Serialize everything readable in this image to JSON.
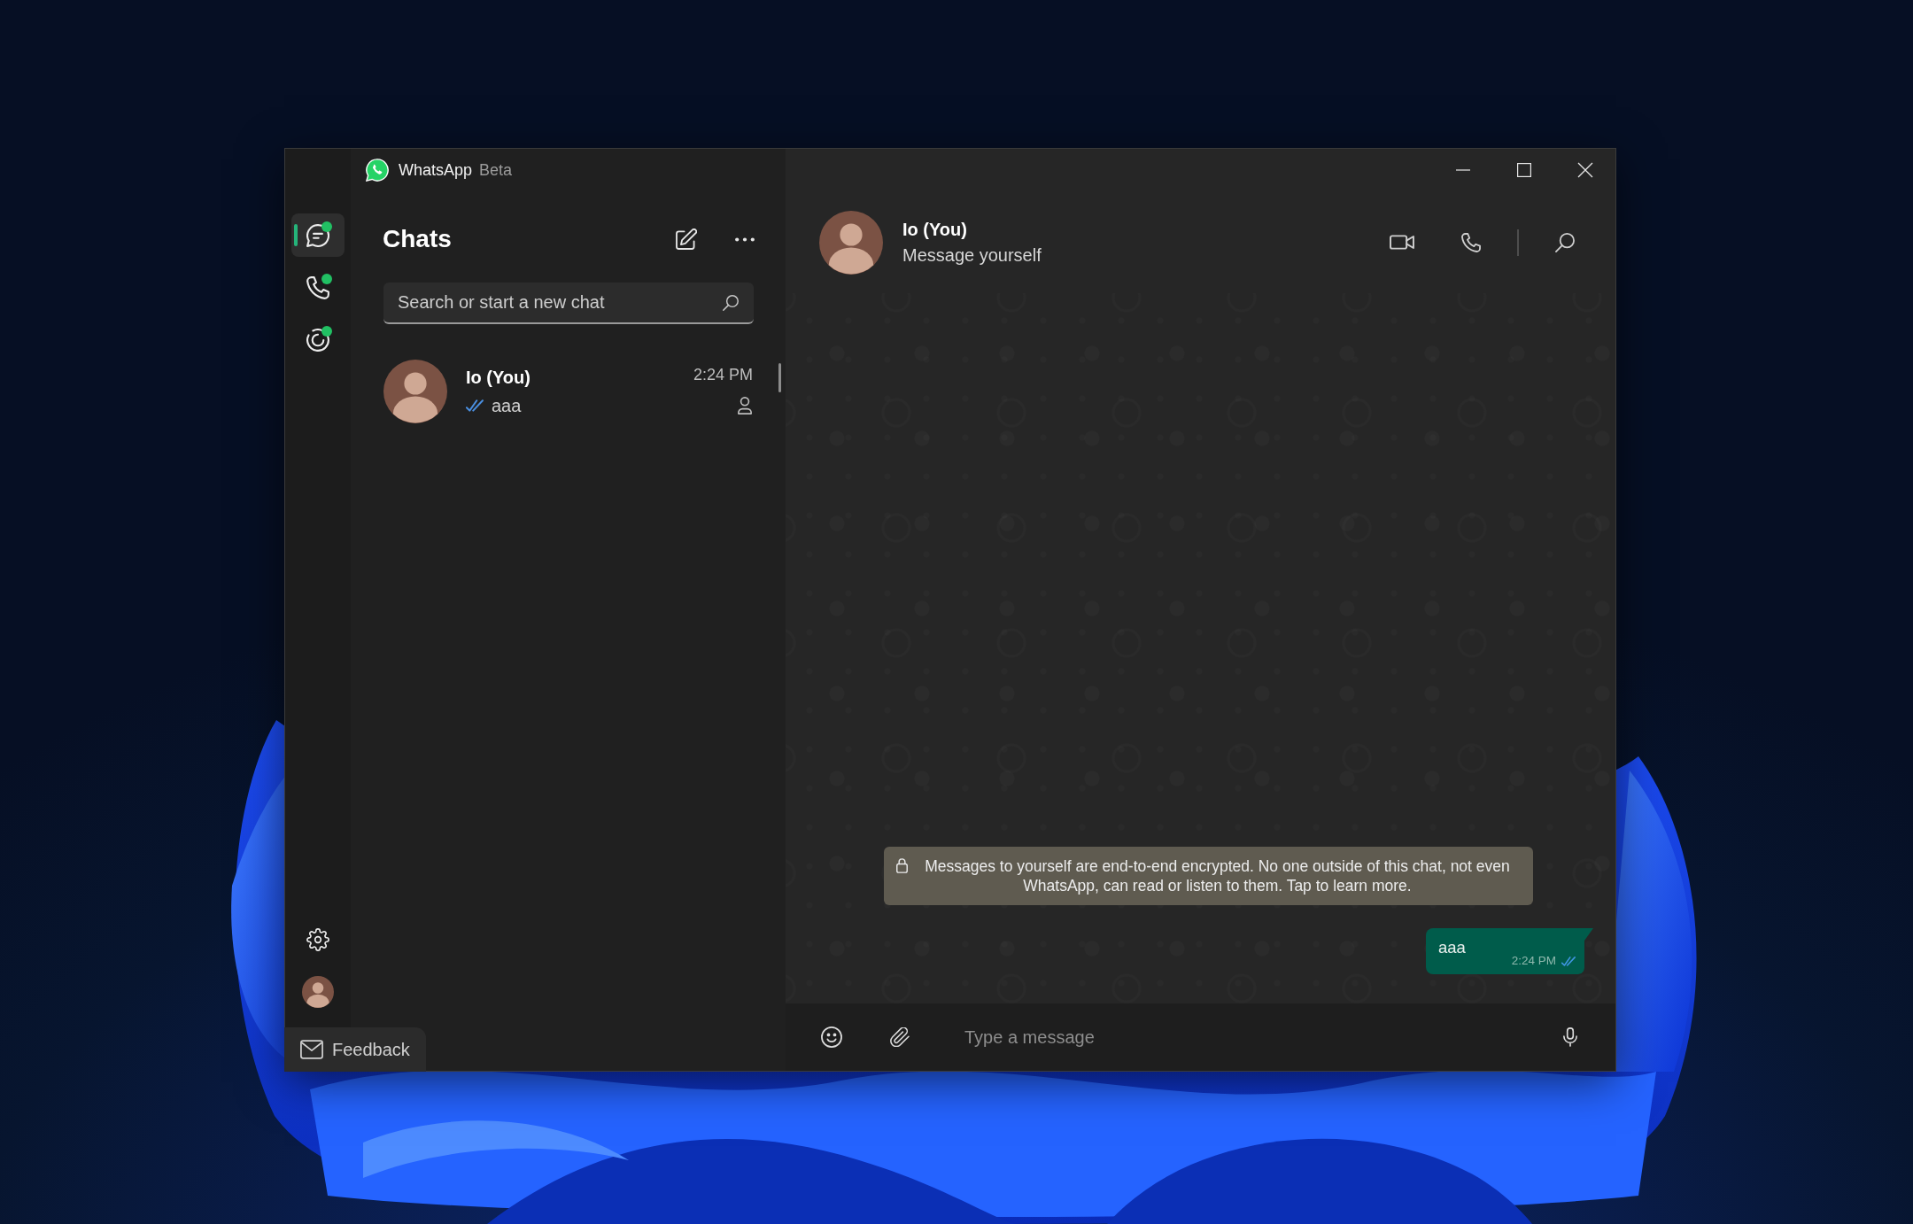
{
  "window": {
    "title": "WhatsApp",
    "edition": "Beta"
  },
  "rail": {
    "items": [
      {
        "kind": "chats",
        "selected": true,
        "notification": true
      },
      {
        "kind": "calls",
        "selected": false,
        "notification": true
      },
      {
        "kind": "status",
        "selected": false,
        "notification": true
      }
    ]
  },
  "chat_list": {
    "title": "Chats",
    "search": {
      "placeholder": "Search or start a new chat"
    },
    "chats": [
      {
        "name": "Io (You)",
        "time": "2:24 PM",
        "preview": "aaa",
        "read": true
      }
    ]
  },
  "conversation": {
    "name": "Io (You)",
    "subtitle": "Message yourself",
    "notice": "Messages to yourself are end-to-end encrypted. No one outside of this chat, not even WhatsApp, can read or listen to them. Tap to learn more.",
    "messages": [
      {
        "text": "aaa",
        "time": "2:24 PM",
        "outgoing": true,
        "read": true
      }
    ],
    "composer": {
      "placeholder": "Type a message"
    }
  },
  "feedback": {
    "label": "Feedback"
  }
}
